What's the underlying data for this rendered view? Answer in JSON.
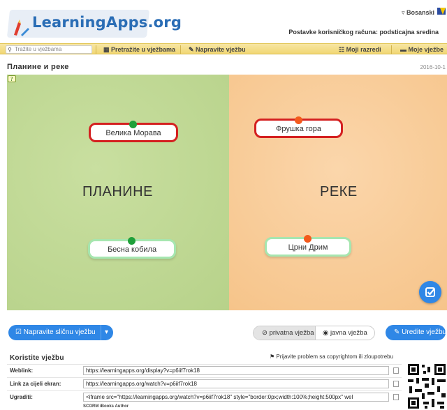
{
  "header": {
    "logo": "LearningApps.org",
    "language": "Bosanski",
    "account": "Postavke korisničkog računa: podsticajna sredina"
  },
  "nav": {
    "search_placeholder": "Tražite u vježbama",
    "browse": "Pretražite u vježbama",
    "create": "Napravite vježbu",
    "classes": "Moji razredi",
    "my_apps": "Moje vježbe"
  },
  "app": {
    "title": "Планине и реке",
    "date": "2016-10-1",
    "zones": [
      {
        "label": "ПЛАНИНЕ",
        "color": "#c1d996"
      },
      {
        "label": "РЕКЕ",
        "color": "#f9cd9c"
      }
    ],
    "cards": [
      {
        "text": "Велика Морава",
        "state": "wrong"
      },
      {
        "text": "Фрушка гора",
        "state": "wrong"
      },
      {
        "text": "Бесна кобила",
        "state": "correct"
      },
      {
        "text": "Црни Дрим",
        "state": "correct"
      }
    ]
  },
  "actions": {
    "similar": "Napravite sličnu vježbu",
    "private": "privatna vježba",
    "public": "javna vježba",
    "edit": "Uredite vježbu"
  },
  "use": {
    "title": "Koristite vježbu",
    "report": "Prijavite problem sa copyrightom ili zloupotrebu",
    "rows": [
      {
        "label": "Weblink:",
        "value": "https://learningapps.org/display?v=p6iif7rok18"
      },
      {
        "label": "Link za cijeli ekran:",
        "value": "https://learningapps.org/watch?v=p6iif7rok18"
      },
      {
        "label": "Ugraditi:",
        "value": "<iframe src=\"https://learningapps.org/watch?v=p6iif7rok18\" style=\"border:0px;width:100%;height:500px\" wel"
      }
    ],
    "export": "SCORM   iBooks Author"
  },
  "colors": {
    "accent_blue": "#2f87e6",
    "nav_yellow": "#f1d774",
    "wrong_red": "#d42020",
    "correct_green": "#1fa03a"
  }
}
